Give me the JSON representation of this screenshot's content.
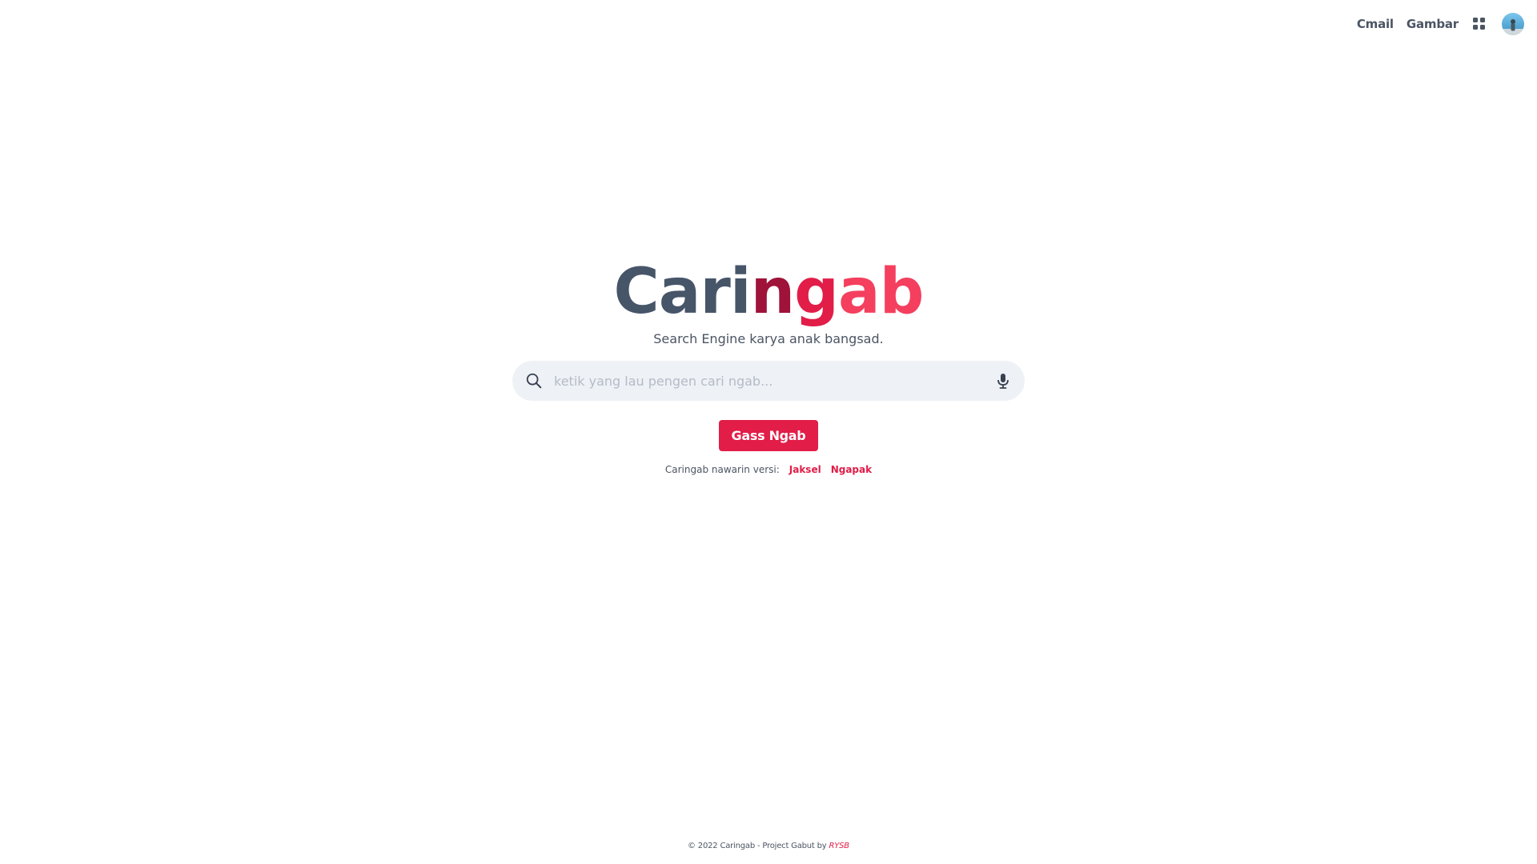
{
  "nav": {
    "links": [
      "Cmail",
      "Gambar"
    ],
    "apps_icon": "grid-apps-icon",
    "avatar_icon": "user-avatar"
  },
  "logo": {
    "part1": "Cari",
    "part2": "n",
    "part3": "g",
    "part4": "ab"
  },
  "tagline": "Search Engine karya anak bangsad.",
  "search": {
    "placeholder": "ketik yang lau pengen cari ngab...",
    "value": "",
    "left_icon": "search-icon",
    "right_icon": "microphone-icon"
  },
  "button": {
    "label": "Gass Ngab"
  },
  "versions": {
    "label": "Caringab nawarin versi:",
    "options": [
      "Jaksel",
      "Ngapak"
    ]
  },
  "footer": {
    "text": "© 2022 Caringab - Project Gabut by",
    "author": "RYSB"
  },
  "colors": {
    "accent": "#e11d48",
    "text": "#4b5563",
    "logo_dark": "#475569",
    "logo_deep_red": "#9f1239",
    "logo_light_red": "#f43f5e",
    "search_bg": "#eef1f5"
  }
}
